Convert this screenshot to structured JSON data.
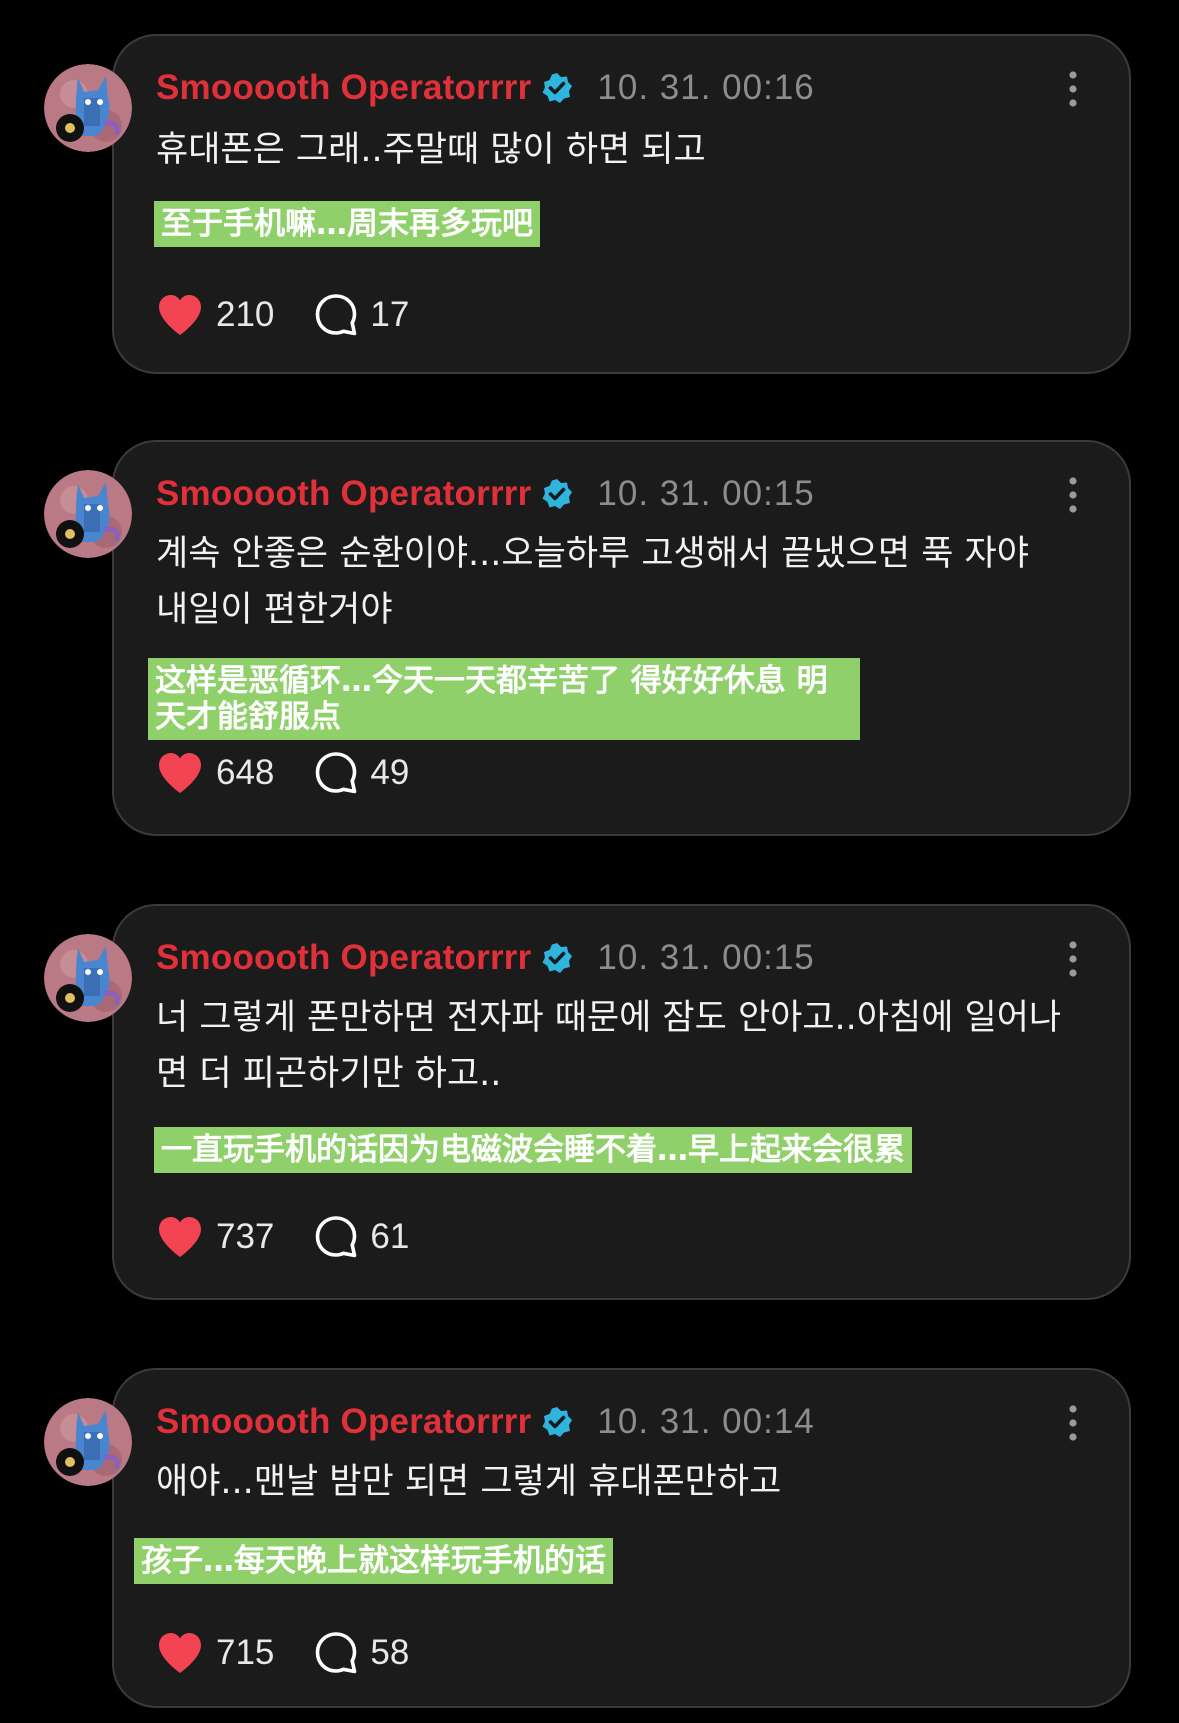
{
  "colors": {
    "background": "#000000",
    "card": "#1b1b1c",
    "username": "#e0303a",
    "verified_badge": "#2fb4de",
    "timestamp": "#8d8d91",
    "heart": "#f24452",
    "translation_highlight": "#8fd06a"
  },
  "icons": {
    "like": "heart-icon",
    "reply": "speech-bubble-icon",
    "verified": "verified-badge-icon",
    "more": "vertical-ellipsis-icon"
  },
  "posts": [
    {
      "username": "Smooooth Operatorrrr",
      "timestamp": "10. 31. 00:16",
      "text": "휴대폰은 그래..주말때 많이 하면 되고",
      "translation": "至于手机嘛…周末再多玩吧",
      "likes": "210",
      "replies": "17"
    },
    {
      "username": "Smooooth Operatorrrr",
      "timestamp": "10. 31. 00:15",
      "text": "계속 안좋은 순환이야...오늘하루 고생해서 끝냈으면 푹 자야 내일이 편한거야",
      "translation": "这样是恶循环…今天一天都辛苦了 得好好休息 明天才能舒服点",
      "likes": "648",
      "replies": "49"
    },
    {
      "username": "Smooooth Operatorrrr",
      "timestamp": "10. 31. 00:15",
      "text": "너 그렇게 폰만하면 전자파 때문에 잠도 안아고..아침에 일어나면 더 피곤하기만 하고..",
      "translation": "一直玩手机的话因为电磁波会睡不着…早上起来会很累",
      "likes": "737",
      "replies": "61"
    },
    {
      "username": "Smooooth Operatorrrr",
      "timestamp": "10. 31. 00:14",
      "text": "애야...맨날 밤만 되면 그렇게 휴대폰만하고",
      "translation": "孩子…每天晚上就这样玩手机的话",
      "likes": "715",
      "replies": "58"
    }
  ]
}
